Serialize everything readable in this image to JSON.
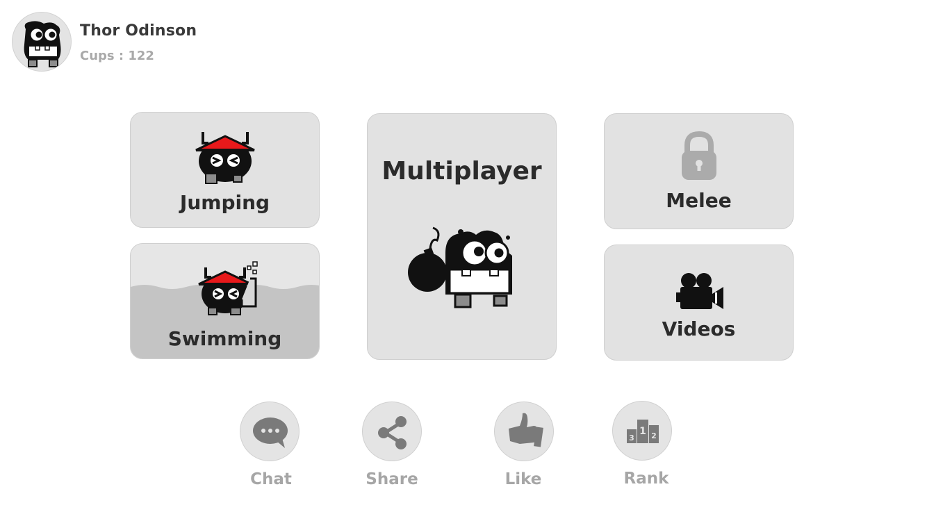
{
  "profile": {
    "name": "Thor Odinson",
    "cups_label": "Cups : ",
    "cups_value": "122",
    "avatar_icon": "monster-face-icon"
  },
  "modes": {
    "jumping": {
      "label": "Jumping",
      "icon": "monster-red-hat-icon"
    },
    "swimming": {
      "label": "Swimming",
      "icon": "monster-snorkel-icon"
    },
    "multiplayer": {
      "label": "Multiplayer",
      "icon": "monster-bomb-icon"
    },
    "melee": {
      "label": "Melee",
      "icon": "lock-icon",
      "locked": true
    },
    "videos": {
      "label": "Videos",
      "icon": "video-camera-icon"
    }
  },
  "actions": [
    {
      "label": "Chat",
      "icon": "chat-bubble-icon"
    },
    {
      "label": "Share",
      "icon": "share-icon"
    },
    {
      "label": "Like",
      "icon": "thumbs-up-icon"
    },
    {
      "label": "Rank",
      "icon": "podium-icon"
    }
  ],
  "colors": {
    "card_bg": "#e2e2e2",
    "hat_red": "#e8191b",
    "muted_text": "#a6a6a6",
    "water": "#c4c4c4"
  }
}
